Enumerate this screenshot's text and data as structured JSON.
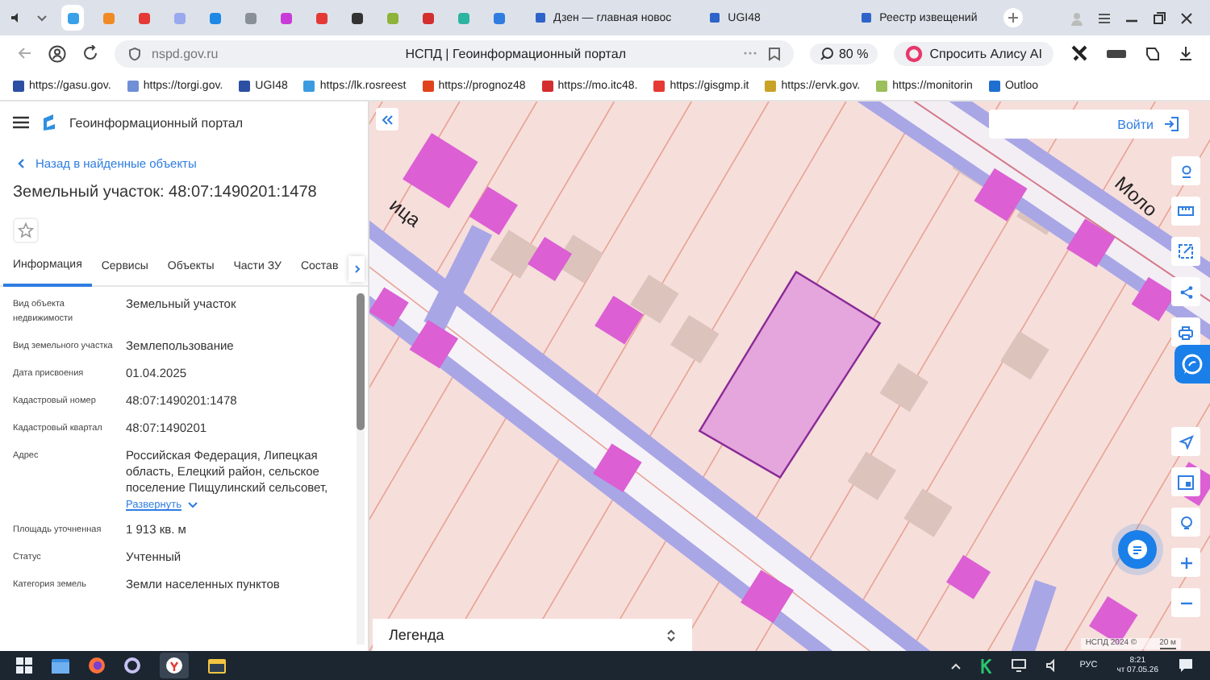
{
  "browser": {
    "pinned_tabs": [
      {
        "color": "#3aa0e8",
        "selected": true
      },
      {
        "color": "#f08a24",
        "selected": false
      },
      {
        "color": "#e53935",
        "selected": false
      },
      {
        "color": "#9aa8f0",
        "selected": false
      },
      {
        "color": "#1e88e5",
        "selected": false
      },
      {
        "color": "#8a9099",
        "selected": false
      },
      {
        "color": "#c93bd6",
        "selected": false
      },
      {
        "color": "#e53935",
        "selected": false
      },
      {
        "color": "#333333",
        "selected": false
      },
      {
        "color": "#8db33a",
        "selected": false
      },
      {
        "color": "#d32f2f",
        "selected": false
      },
      {
        "color": "#2bb5a0",
        "selected": false
      },
      {
        "color": "#2f7de1",
        "selected": false
      }
    ],
    "tabs": [
      {
        "title": "Дзен — главная новос",
        "selected": false
      },
      {
        "title": "UGI48",
        "selected": false
      },
      {
        "title": "Реестр извещений",
        "selected": false
      }
    ],
    "url": "nspd.gov.ru",
    "page_title": "НСПД | Геоинформационный портал",
    "zoom": "80 %",
    "alice": "Спросить Алису AI",
    "bookmarks": [
      {
        "label": "https://gasu.gov.",
        "color": "#2d4fa3"
      },
      {
        "label": "https://torgi.gov.",
        "color": "#6f8fd6"
      },
      {
        "label": "UGI48",
        "color": "#2d4fa3"
      },
      {
        "label": "https://lk.rosreest",
        "color": "#3b9be0"
      },
      {
        "label": "https://prognoz48",
        "color": "#e0431b"
      },
      {
        "label": "https://mo.itc48.",
        "color": "#d32f2f"
      },
      {
        "label": "https://gisgmp.it",
        "color": "#e53935"
      },
      {
        "label": "https://ervk.gov.",
        "color": "#c9a227"
      },
      {
        "label": "https://monitorin",
        "color": "#9bbf5a"
      },
      {
        "label": "Outloo",
        "color": "#1e6fd0"
      }
    ]
  },
  "portal": {
    "title": "Геоинформационный портал",
    "back": "Назад в найденные объекты",
    "heading": "Земельный участок: 48:07:1490201:1478",
    "tabs": [
      {
        "label": "Информация",
        "selected": true
      },
      {
        "label": "Сервисы",
        "selected": false
      },
      {
        "label": "Объекты",
        "selected": false
      },
      {
        "label": "Части ЗУ",
        "selected": false
      },
      {
        "label": "Состав",
        "selected": false
      }
    ],
    "fields": [
      {
        "label": "Вид объекта недвижимости",
        "value": "Земельный участок"
      },
      {
        "label": "Вид земельного участка",
        "value": "Землепользование"
      },
      {
        "label": "Дата присвоения",
        "value": "01.04.2025"
      },
      {
        "label": "Кадастровый номер",
        "value": "48:07:1490201:1478"
      },
      {
        "label": "Кадастровый квартал",
        "value": "48:07:1490201"
      },
      {
        "label": "Адрес",
        "value": "Российская Федерация, Липецкая область, Елецкий район, сельское поселение Пищулинский сельсовет,",
        "expand": "Развернуть"
      },
      {
        "label": "Площадь уточненная",
        "value": "1 913 кв. м"
      },
      {
        "label": "Статус",
        "value": "Учтенный"
      },
      {
        "label": "Категория земель",
        "value": "Земли населенных пунктов"
      }
    ]
  },
  "map": {
    "login": "Войти",
    "legend": "Легенда",
    "street_labels": [
      "ица",
      "Моло"
    ],
    "attribution": "НСПД 2024 ©",
    "scale": "20 м"
  },
  "taskbar": {
    "language": "РУС",
    "time": "8:21",
    "date": "чт 07.05.26"
  }
}
